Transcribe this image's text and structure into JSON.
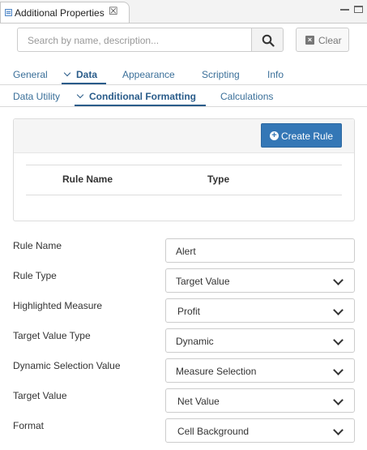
{
  "view": {
    "title": "Additional Properties",
    "close_icon": "close-icon",
    "minimize_icon": "minimize-icon",
    "maximize_icon": "maximize-icon"
  },
  "search": {
    "placeholder": "Search by name, description...",
    "value": "",
    "button_icon": "search-icon",
    "clear_label": "Clear"
  },
  "tabs": [
    {
      "label": "General"
    },
    {
      "label": "Data",
      "active": true
    },
    {
      "label": "Appearance"
    },
    {
      "label": "Scripting"
    },
    {
      "label": "Info"
    }
  ],
  "subtabs": [
    {
      "label": "Data Utility"
    },
    {
      "label": "Conditional Formatting",
      "active": true
    },
    {
      "label": "Calculations"
    }
  ],
  "rules": {
    "create_label": "Create Rule",
    "columns": [
      "Rule Name",
      "Type"
    ],
    "rows": []
  },
  "form": [
    {
      "label": "Rule Name",
      "value": "Alert",
      "type": "text"
    },
    {
      "label": "Rule Type",
      "value": "Target Value",
      "type": "select"
    },
    {
      "label": "Highlighted Measure",
      "value": "Profit",
      "type": "select"
    },
    {
      "label": "Target Value Type",
      "value": "Dynamic",
      "type": "select"
    },
    {
      "label": "Dynamic Selection Value",
      "value": "Measure Selection",
      "type": "select"
    },
    {
      "label": "Target Value",
      "value": "Net Value",
      "type": "select"
    },
    {
      "label": "Format",
      "value": "Cell Background",
      "type": "select"
    }
  ],
  "colors": {
    "accent": "#3477b6",
    "tab_text": "#3a6f99"
  }
}
